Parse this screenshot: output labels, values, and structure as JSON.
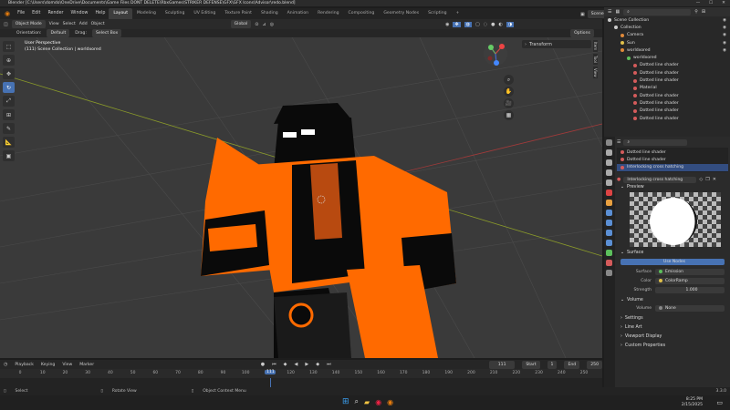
{
  "window": {
    "title": "Blender [C:\\Users\\domdo\\OneDrive\\Documents\\Game Files DONT DELETE\\RbxGames\\STRIKER DEFENSE\\GFX\\GFX Icons\\Advisor\\redo.blend]",
    "controls": [
      "—",
      "☐",
      "✕"
    ]
  },
  "menubar": {
    "menus": [
      "File",
      "Edit",
      "Render",
      "Window",
      "Help"
    ],
    "workspaces": [
      "Layout",
      "Modeling",
      "Sculpting",
      "UV Editing",
      "Texture Paint",
      "Shading",
      "Animation",
      "Rendering",
      "Compositing",
      "Geometry Nodes",
      "Scripting"
    ],
    "active_workspace": "Layout",
    "scene": "Scene",
    "view_layer": "ViewLayer"
  },
  "viewport_header": {
    "mode": "Object Mode",
    "menus": [
      "View",
      "Select",
      "Add",
      "Object"
    ],
    "transform_orientation": "Global",
    "options": "Options"
  },
  "viewport_header2": {
    "orientation_label": "Orientation:",
    "orientation_value": "Default",
    "drag_label": "Drag:",
    "drag_value": "Select Box"
  },
  "viewport": {
    "perspective": "User Perspective",
    "collection": "(111) Scene Collection | worldxored",
    "transform_tab": "Transform",
    "ntabs": [
      "Item",
      "Tool",
      "View"
    ],
    "colors": {
      "bg": "#3a3a3a",
      "model_orange": "#ff6a00",
      "model_black": "#0a0a0a"
    }
  },
  "toolbar": {
    "tools": [
      "select-box-icon",
      "cursor-icon",
      "move-icon",
      "rotate-icon",
      "scale-icon",
      "transform-icon",
      "annotate-icon",
      "measure-icon",
      "add-cube-icon"
    ]
  },
  "timeline": {
    "menus": [
      "Playback",
      "Keying",
      "View",
      "Marker"
    ],
    "current_frame": "111",
    "start_label": "Start",
    "start": "1",
    "end_label": "End",
    "end": "250",
    "ticks": [
      "0",
      "10",
      "20",
      "30",
      "40",
      "50",
      "60",
      "70",
      "80",
      "90",
      "100",
      "110",
      "120",
      "130",
      "140",
      "150",
      "160",
      "170",
      "180",
      "190",
      "200",
      "210",
      "220",
      "230",
      "240",
      "250"
    ],
    "playhead": "111"
  },
  "statusbar": {
    "items": [
      "Select",
      "Rotate View",
      "Object Context Menu"
    ],
    "version": "3.3.0"
  },
  "outliner": {
    "items": [
      {
        "label": "Scene Collection",
        "depth": 0,
        "icon": "#cccccc"
      },
      {
        "label": "Collection",
        "depth": 1,
        "icon": "#cccccc"
      },
      {
        "label": "Camera",
        "depth": 2,
        "icon": "#e08a3a"
      },
      {
        "label": "Sun",
        "depth": 2,
        "icon": "#e0c04a"
      },
      {
        "label": "worldxored",
        "depth": 2,
        "icon": "#e08a3a"
      },
      {
        "label": "worldxored",
        "depth": 3,
        "icon": "#5cbf5c"
      },
      {
        "label": "Dotted line shader",
        "depth": 4,
        "icon": "#d45b5b"
      },
      {
        "label": "Dotted line shader",
        "depth": 4,
        "icon": "#d45b5b"
      },
      {
        "label": "Dotted line shader",
        "depth": 4,
        "icon": "#d45b5b"
      },
      {
        "label": "Material",
        "depth": 4,
        "icon": "#d45b5b"
      },
      {
        "label": "Dotted line shader",
        "depth": 4,
        "icon": "#d45b5b"
      },
      {
        "label": "Dotted line shader",
        "depth": 4,
        "icon": "#d45b5b"
      },
      {
        "label": "Dotted line shader",
        "depth": 4,
        "icon": "#d45b5b"
      },
      {
        "label": "Dotted line shader",
        "depth": 4,
        "icon": "#d45b5b"
      }
    ]
  },
  "properties": {
    "slots": [
      "Dotted line shader",
      "Dotted line shader",
      "Interlocking cross hatching"
    ],
    "material_name": "Interlocking cross hatching",
    "preview_label": "Preview",
    "surface_label": "Surface",
    "use_nodes": "Use Nodes",
    "surface_field_label": "Surface",
    "surface_value": "Emission",
    "color_label": "Color",
    "color_value": "ColorRamp",
    "strength_label": "Strength",
    "strength_value": "1.000",
    "volume_section": "Volume",
    "volume_label": "Volume",
    "volume_value": "None",
    "sections": [
      "Settings",
      "Line Art",
      "Viewport Display",
      "Custom Properties"
    ]
  },
  "taskbar": {
    "time": "8:25 PM",
    "date": "2/15/2025"
  }
}
